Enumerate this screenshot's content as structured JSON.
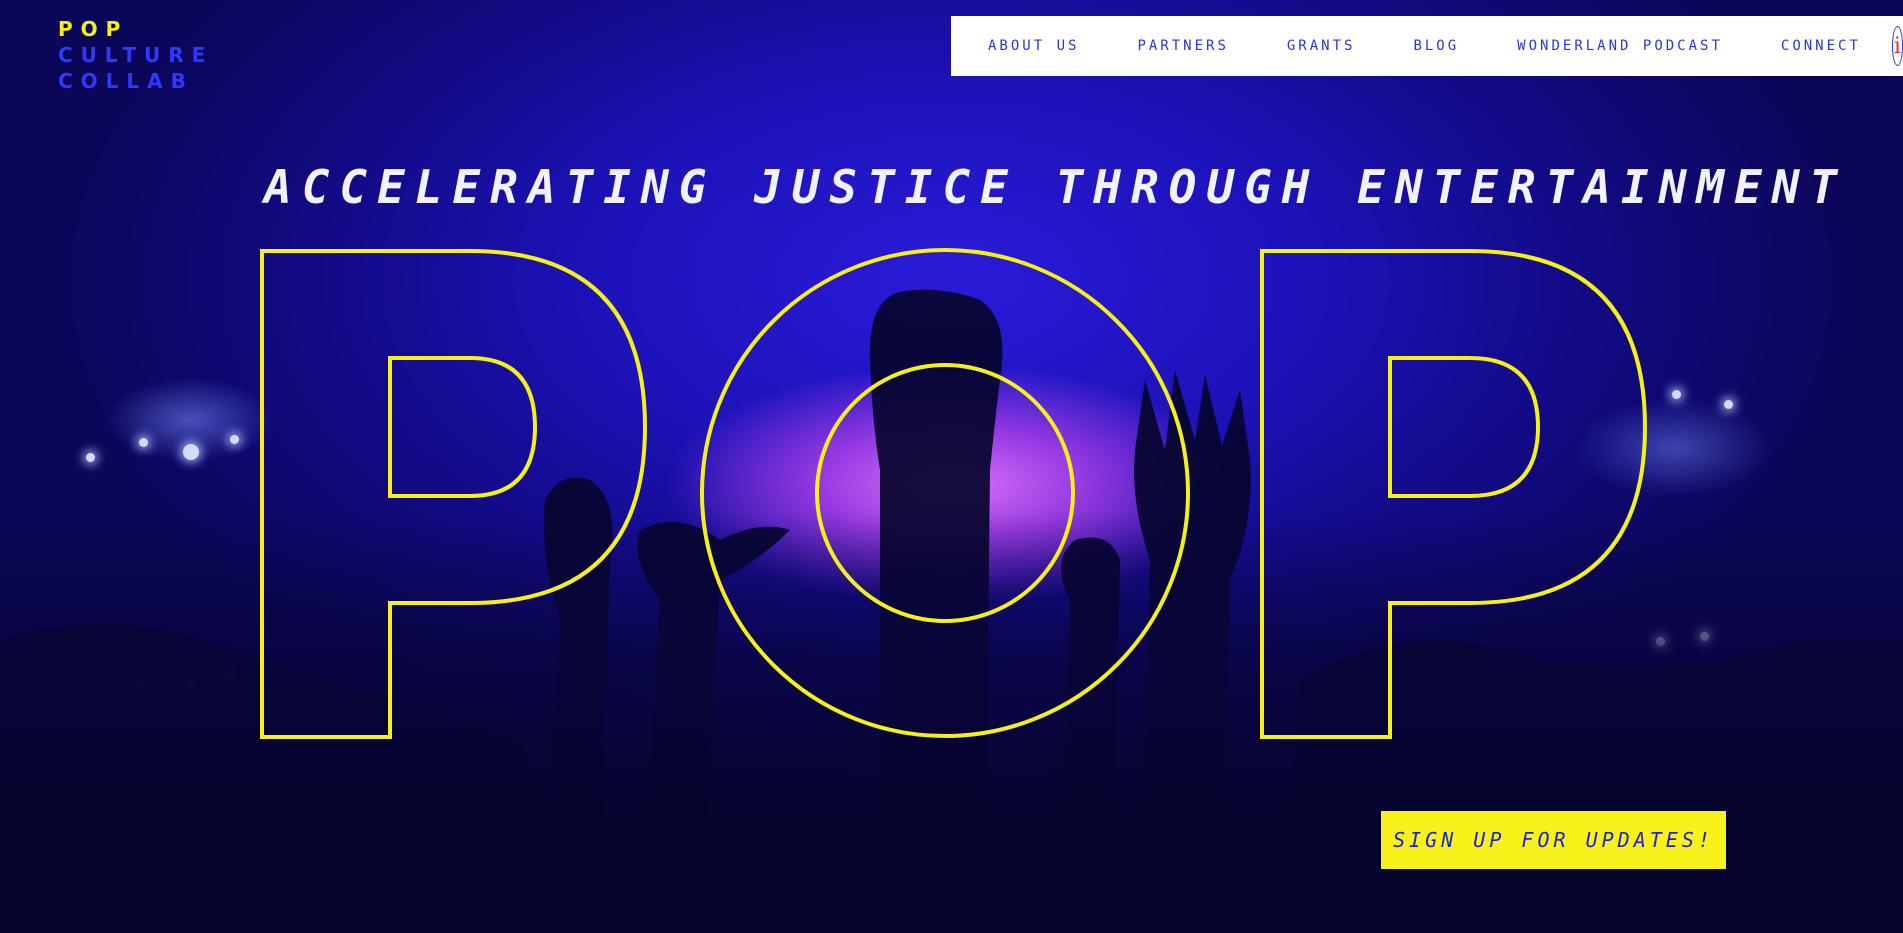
{
  "logo": {
    "line1": "POP",
    "line2": "CULTURE",
    "line3": "COLLAB"
  },
  "nav": {
    "items": [
      "ABOUT US",
      "PARTNERS",
      "GRANTS",
      "BLOG",
      "WONDERLAND PODCAST",
      "CONNECT"
    ],
    "info_icon": "i"
  },
  "hero": {
    "tagline": "ACCELERATING JUSTICE THROUGH ENTERTAINMENT",
    "big_word": "POP",
    "cta_label": "SIGN UP FOR UPDATES!"
  },
  "colors": {
    "accent_yellow": "#f8f21a",
    "brand_blue": "#2c33e8",
    "info_red": "#e0303c"
  }
}
